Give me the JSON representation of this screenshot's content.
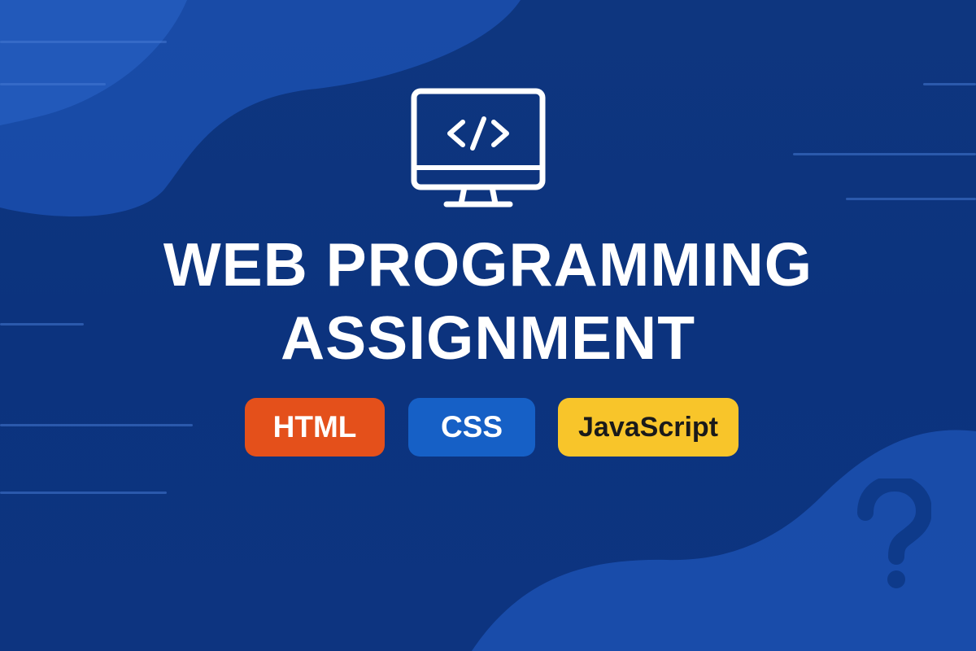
{
  "title": {
    "line1": "WEB PROGRAMMING",
    "line2": "ASSIGNMENT"
  },
  "badges": [
    {
      "label": "HTML",
      "color": "#e4501b",
      "text_color": "#ffffff"
    },
    {
      "label": "CSS",
      "color": "#1660c6",
      "text_color": "#ffffff"
    },
    {
      "label": "JavaScript",
      "color": "#f8c52a",
      "text_color": "#1a1a1a"
    }
  ],
  "icons": {
    "monitor": "monitor-code-icon",
    "code_glyph": "</>",
    "question": "question-mark-icon"
  },
  "colors": {
    "background": "#0d3480",
    "blob": "#1a4fb0",
    "accent_line": "#3f73cc"
  }
}
